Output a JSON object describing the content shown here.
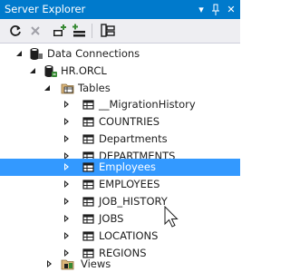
{
  "panel": {
    "title": "Server Explorer",
    "title_buttons": {
      "dropdown_glyph": "▾",
      "pin_glyph": "⊢",
      "close_glyph": "✕"
    }
  },
  "toolbar": {
    "buttons": [
      {
        "name": "refresh",
        "icon": "refresh-icon"
      },
      {
        "name": "stop-refresh",
        "icon": "close-icon"
      },
      {
        "name": "connect-to-database",
        "icon": "connect-to-database-icon"
      },
      {
        "name": "connect-to-server",
        "icon": "connect-to-server-icon"
      },
      {
        "name": "connect-to-sharepoint",
        "icon": "sharepoint-icon"
      }
    ]
  },
  "tree": {
    "data_connections": {
      "label": "Data Connections",
      "expanded": true,
      "icon": "database-icon"
    },
    "connection": {
      "label": "HR.ORCL",
      "expanded": true,
      "icon": "database-connection-icon"
    },
    "tables_folder": {
      "label": "Tables",
      "expanded": true,
      "icon": "folder-icon"
    },
    "tables": [
      {
        "label": "__MigrationHistory"
      },
      {
        "label": "COUNTRIES"
      },
      {
        "label": "Departments"
      },
      {
        "label": "DEPARTMENTS"
      },
      {
        "label": "Employees",
        "selected": true
      },
      {
        "label": "EMPLOYEES"
      },
      {
        "label": "JOB_HISTORY"
      },
      {
        "label": "JOBS"
      },
      {
        "label": "LOCATIONS"
      },
      {
        "label": "REGIONS"
      }
    ],
    "views_folder": {
      "label": "Views",
      "expanded": false,
      "icon": "folder-icon"
    }
  },
  "colors": {
    "title_bar": "#007acc",
    "toolbar": "#eeeef2",
    "selection": "#3399ff",
    "text": "#1e1e1e"
  }
}
